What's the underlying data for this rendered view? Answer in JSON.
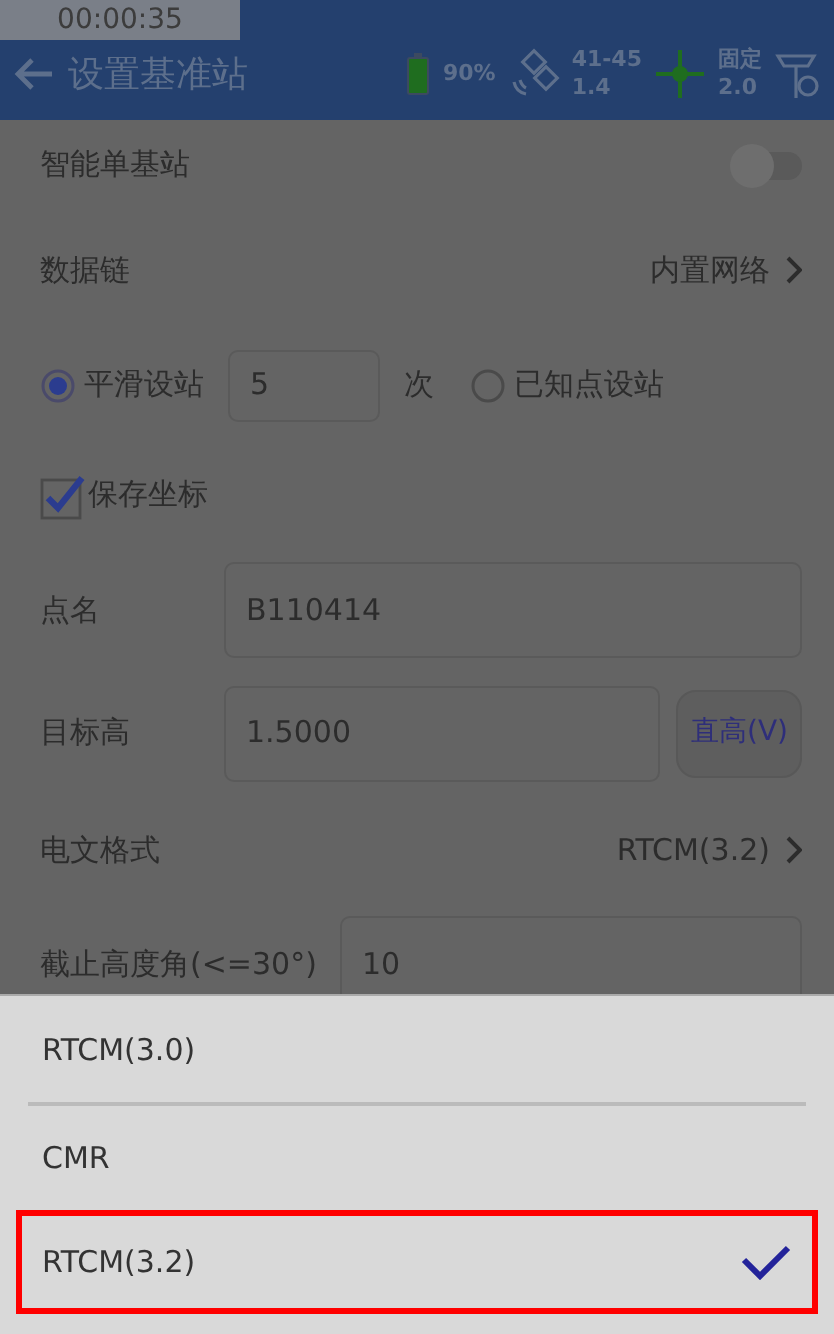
{
  "recorder_timer": "00:00:35",
  "header": {
    "title": "设置基准站",
    "battery": "90%",
    "satellites": "41-45",
    "pdop": "1.4",
    "solution": "固定",
    "age": "2.0"
  },
  "rows": [
    {
      "kind": "toggle",
      "label": "智能单基站",
      "on": false
    },
    {
      "kind": "link",
      "label": "数据链",
      "value": "内置网络"
    },
    {
      "kind": "radios",
      "options": [
        {
          "label": "平滑设站",
          "selected": true
        },
        {
          "label": "已知点设站",
          "selected": false
        }
      ],
      "count": "5",
      "unit": "次"
    },
    {
      "kind": "checkbox",
      "label": "保存坐标",
      "checked": true
    },
    {
      "kind": "field",
      "label": "点名",
      "value": "B110414"
    },
    {
      "kind": "field",
      "label": "目标高",
      "value": "1.5000",
      "button": "直高(V)"
    },
    {
      "kind": "link",
      "label": "电文格式",
      "value": "RTCM(3.2)"
    },
    {
      "kind": "field",
      "label": "截止高度角(<=30°)",
      "value": "10"
    }
  ],
  "sheet": [
    {
      "label": "RTCM(3.0)",
      "selected": false,
      "highlighted": false
    },
    {
      "label": "CMR",
      "selected": false,
      "highlighted": false
    },
    {
      "label": "RTCM(3.2)",
      "selected": true,
      "highlighted": true
    }
  ]
}
